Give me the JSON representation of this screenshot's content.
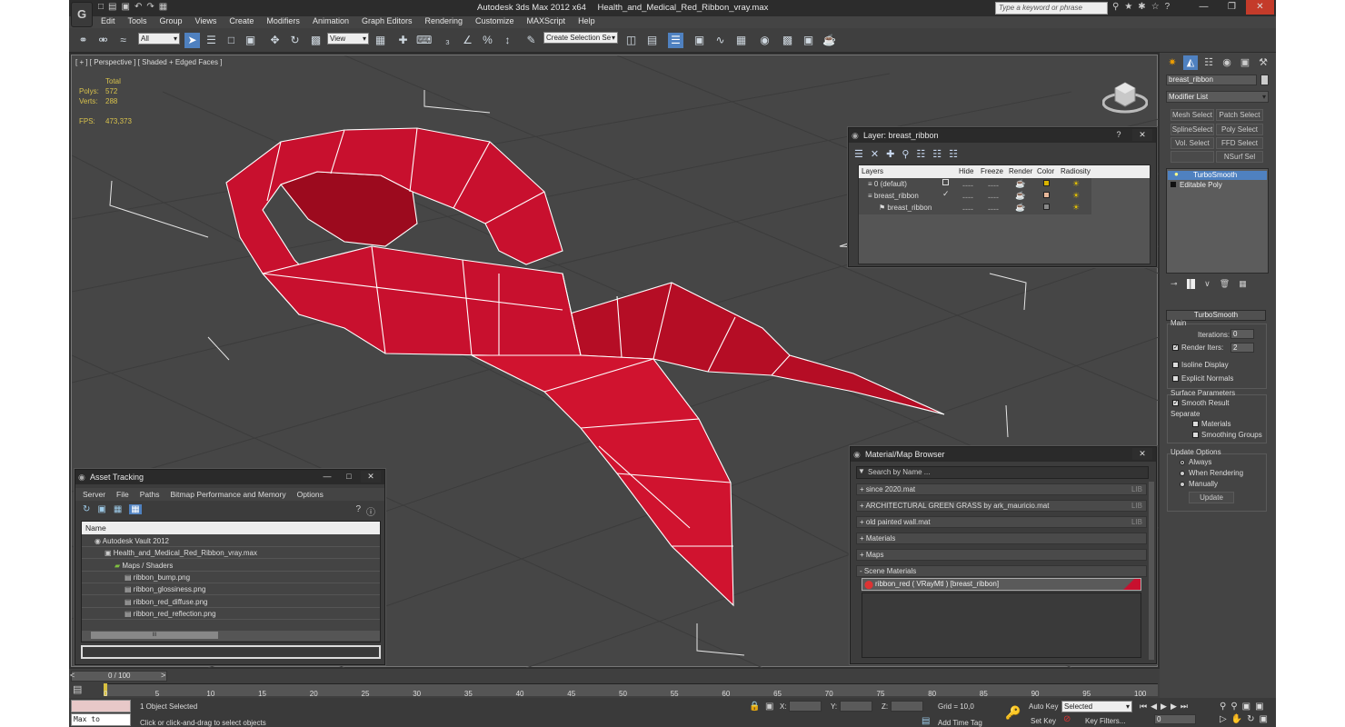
{
  "app": {
    "title": "Autodesk 3ds Max  2012 x64",
    "filename": "Health_and_Medical_Red_Ribbon_vray.max",
    "logo": "G",
    "search_placeholder": "Type a keyword or phrase",
    "menu": [
      "Edit",
      "Tools",
      "Group",
      "Views",
      "Create",
      "Modifiers",
      "Animation",
      "Graph Editors",
      "Rendering",
      "Customize",
      "MAXScript",
      "Help"
    ]
  },
  "toolbar": {
    "filter_value": "All",
    "refcoord_value": "View",
    "selection_set_placeholder": "Create Selection Se"
  },
  "viewport": {
    "label": "[ + ] [ Perspective ] [ Shaded + Edged Faces ]",
    "stats": {
      "header": "Total",
      "polys_label": "Polys:",
      "polys_value": "572",
      "verts_label": "Verts:",
      "verts_value": "288",
      "fps_label": "FPS:",
      "fps_value": "473,373"
    }
  },
  "layer_window": {
    "title": "Layer: breast_ribbon",
    "help": "?",
    "close": "✕",
    "columns": [
      "Layers",
      "Hide",
      "Freeze",
      "Render",
      "Color",
      "Radiosity"
    ],
    "rows": [
      {
        "name": "0 (default)",
        "color": "#d9b400"
      },
      {
        "name": "breast_ribbon",
        "color": "#e8b89a"
      },
      {
        "name": "breast_ribbon",
        "color": "#888888"
      }
    ],
    "dashes": "----"
  },
  "asset_window": {
    "title": "Asset Tracking",
    "menu": [
      "Server",
      "File",
      "Paths",
      "Bitmap Performance and Memory",
      "Options"
    ],
    "column": "Name",
    "items": [
      {
        "label": "Autodesk Vault 2012",
        "indent": 0
      },
      {
        "label": "Health_and_Medical_Red_Ribbon_vray.max",
        "indent": 1
      },
      {
        "label": "Maps / Shaders",
        "indent": 2
      },
      {
        "label": "ribbon_bump.png",
        "indent": 3
      },
      {
        "label": "ribbon_glossiness.png",
        "indent": 3
      },
      {
        "label": "ribbon_red_diffuse.png",
        "indent": 3
      },
      {
        "label": "ribbon_red_reflection.png",
        "indent": 3
      }
    ],
    "scroll_label": "III"
  },
  "material_window": {
    "title": "Material/Map Browser",
    "search_placeholder": "Search by Name ...",
    "rows": [
      {
        "label": "+ since 2020.mat",
        "lib": "LIB"
      },
      {
        "label": "+ ARCHITECTURAL GREEN GRASS by ark_mauricio.mat",
        "lib": "LIB"
      },
      {
        "label": "+ old painted wall.mat",
        "lib": "LIB"
      },
      {
        "label": "+ Materials",
        "lib": ""
      },
      {
        "label": "+ Maps",
        "lib": ""
      },
      {
        "label": "- Scene Materials",
        "lib": ""
      }
    ],
    "scene_material": "ribbon_red  ( VRayMtl )  [breast_ribbon]"
  },
  "command_panel": {
    "object_name": "breast_ribbon",
    "modifier_list": "Modifier List",
    "buttons": [
      "Mesh Select",
      "Patch Select",
      "SplineSelect",
      "Poly Select",
      "Vol. Select",
      "FFD Select",
      "NSurf Sel"
    ],
    "stack": [
      "TurboSmooth",
      "Editable Poly"
    ],
    "rollout_title": "TurboSmooth",
    "main_label": "Main",
    "iterations_label": "Iterations:",
    "iterations_value": "0",
    "render_iters_label": "Render Iters:",
    "render_iters_value": "2",
    "isoline_label": "Isoline Display",
    "explicit_label": "Explicit Normals",
    "surface_label": "Surface Parameters",
    "smooth_label": "Smooth Result",
    "separate_label": "Separate",
    "materials_label": "Materials",
    "smoothing_label": "Smoothing Groups",
    "update_options_label": "Update Options",
    "always_label": "Always",
    "when_rendering_label": "When Rendering",
    "manually_label": "Manually",
    "update_button": "Update"
  },
  "timeline": {
    "frame": "0 / 100",
    "ticks": [
      "0",
      "5",
      "10",
      "15",
      "20",
      "25",
      "30",
      "35",
      "40",
      "45",
      "50",
      "55",
      "60",
      "65",
      "70",
      "75",
      "80",
      "85",
      "90",
      "95",
      "100"
    ]
  },
  "status": {
    "script_label": "Max to Physc.",
    "selected": "1 Object Selected",
    "prompt": "Click or click-and-drag to select objects",
    "x_label": "X:",
    "y_label": "Y:",
    "z_label": "Z:",
    "grid": "Grid = 10,0",
    "add_time_tag": "Add Time Tag",
    "auto_key": "Auto Key",
    "selected_value": "Selected",
    "set_key": "Set Key",
    "key_filters": "Key Filters...",
    "frame_value": "0"
  },
  "colors": {
    "accent": "#4f81c0",
    "ribbon": "#c8102e",
    "wire": "#ffffff"
  }
}
